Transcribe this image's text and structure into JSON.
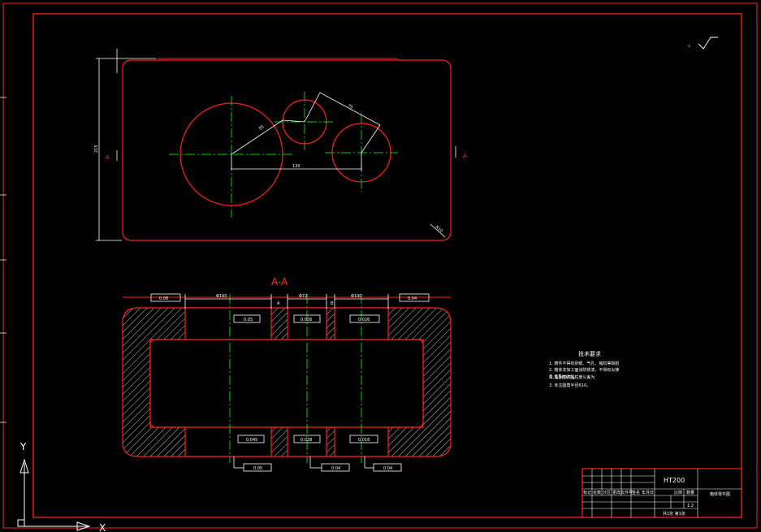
{
  "colors": {
    "background": "#000000",
    "border": "#ff2020",
    "geometry": "#ff2020",
    "centerline": "#00cc00",
    "dimension": "#ffffff",
    "hatch": "#c8c8c8"
  },
  "top_view": {
    "dims": {
      "overall_height": "215",
      "link_left": "95",
      "link_right": "75",
      "horizontal": "130",
      "corner": "R10"
    },
    "section_marks": {
      "left": "A",
      "right": "A"
    }
  },
  "section_view": {
    "title": "A-A",
    "bore_dims": [
      "Φ160",
      "Φ72",
      "Φ100"
    ],
    "tolerances": {
      "parallel_top_left": "0.06",
      "parallel_top_right": "0.04",
      "bore_top": [
        "0.05",
        "0.026",
        "0.026"
      ],
      "bore_bottom": [
        "0.045",
        "0.028",
        "0.018"
      ],
      "bottom_frames": [
        "0.05",
        "0.04",
        "0.04"
      ],
      "datum_left": "A",
      "datum_right": "B"
    }
  },
  "roughness_symbol": "√",
  "notes": {
    "title": "技术要求",
    "items": [
      "1.  铸件不得有砂眼、气孔、缩松等缺陷",
      "2.  箱体非加工面涂防锈漆，不得有尖棱",
      "3.  轴承座孔圆柱度公差为",
      "0.15mm。",
      "3.  未注圆角半径R10。"
    ]
  },
  "title_block": {
    "material": "HT200",
    "name": "箱体零件图",
    "scale": "1:2",
    "ratio_label": "比例",
    "qty_label": "数量",
    "drawing_no": "共1张 第1张",
    "labels": [
      "标记",
      "处数",
      "分区",
      "更改文件号",
      "签名",
      "年月日"
    ]
  },
  "ucs": {
    "x": "X",
    "y": "Y"
  }
}
